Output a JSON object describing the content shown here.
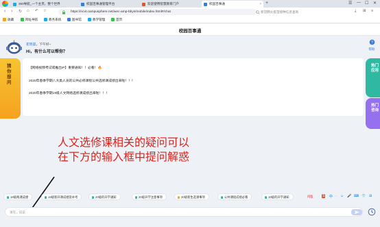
{
  "browser": {
    "tabs": [
      {
        "label": "360导航_一个主页，整个世界",
        "active": false,
        "color": "#1fa8e8"
      },
      {
        "label": "校园百事通管理平台",
        "active": false,
        "color": "#3a7bd5"
      },
      {
        "label": "欢迎使用智慧教育门户",
        "active": false,
        "color": "#e2552b"
      },
      {
        "label": "校园百事通",
        "active": true,
        "color": "#3a7bd5"
      }
    ],
    "plus": "+",
    "window_controls": [
      "☰",
      "—",
      "☐",
      "✕"
    ],
    "url": "https://ncvt.campusphere.net/wec-amp-bbys/mobile/index.html#/chat",
    "search_placeholder": "新冠肺炎疫苗接种信息查询",
    "bookmarks": [
      {
        "label": "收藏",
        "color": "#f6a21e"
      },
      {
        "label": "网址导航",
        "color": "#36c24b"
      },
      {
        "label": "教务系统",
        "color": "#1fa8e8"
      },
      {
        "label": "图书馆",
        "color": "#3a7bd5"
      },
      {
        "label": "教学管理",
        "color": "#1fa8e8"
      },
      {
        "label": "首页",
        "color": "#36c24b"
      }
    ]
  },
  "page": {
    "title": "校园百事通",
    "greeting_name": "崔晓晨",
    "greeting_suffix": "，下午好~",
    "greeting_main": "Hi，有什么可以帮你？",
    "help_label": "帮助",
    "left_banner": "猜你想问",
    "right_banner1": "热门应用",
    "right_banner2": "热门咨询",
    "notices": [
      {
        "text": "【网络视频考试或推出IP】重要通知！！必看！",
        "fire": "🔥"
      },
      {
        "text": "2020年春季学期八大类人员的公共必修课程公共选修课成绩出来啦！！！",
        "fire": ""
      },
      {
        "text": "2020年春季学期19级人文网络选修课成绩出来啦！！！",
        "fire": ""
      }
    ],
    "overlay_line1": "人文选修课相关的疑问可以",
    "overlay_line2": "在下方的输入框中提问解惑",
    "chips": [
      {
        "label": "18级两课成绩",
        "color": "#2fb9a2"
      },
      {
        "label": "19级新开课成绩及补考",
        "color": "#2fb9a2"
      },
      {
        "label": "20级的开学通知",
        "color": "#2fb9a2"
      },
      {
        "label": "20级开学注意事项",
        "color": "#2fb9a2"
      },
      {
        "label": "20级新生选课事项",
        "color": "#f6a21e"
      },
      {
        "label": "公共课程成绩必看",
        "color": "#2fb9a2"
      },
      {
        "label": "19级的开学通知",
        "color": "#2fb9a2"
      },
      {
        "label": "20级的开学通知",
        "color": "#2fb9a2"
      }
    ],
    "chip_more": "问医",
    "tray": [
      "S",
      "中",
      "·",
      "☺",
      "🎤",
      "⌨",
      "👕",
      "⊞"
    ],
    "input_placeholder": "请在，说说",
    "colors": {
      "accent": "#3a7bd5",
      "overlay": "#e0221b",
      "banner_yellow": "#f7c431",
      "banner_teal": "#2fb9a2",
      "banner_purple": "#9570ef"
    }
  }
}
